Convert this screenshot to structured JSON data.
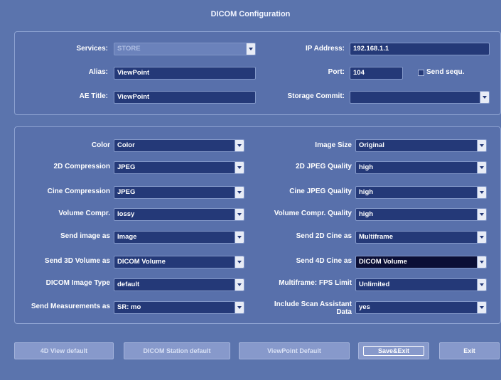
{
  "title": "DICOM Configuration",
  "top": {
    "services": {
      "label": "Services:",
      "value": "STORE"
    },
    "alias": {
      "label": "Alias:",
      "value": "ViewPoint"
    },
    "ae_title": {
      "label": "AE Title:",
      "value": "ViewPoint"
    },
    "ip_address": {
      "label": "IP Address:",
      "value": "192.168.1.1"
    },
    "port": {
      "label": "Port:",
      "value": "104"
    },
    "send_sequ": {
      "label": "Send sequ.",
      "checked": false
    },
    "storage_commit": {
      "label": "Storage Commit:",
      "value": ""
    }
  },
  "settings": {
    "color": {
      "label": "Color",
      "value": "Color"
    },
    "compression_2d": {
      "label": "2D Compression",
      "value": "JPEG"
    },
    "cine_compression": {
      "label": "Cine Compression",
      "value": "JPEG"
    },
    "volume_compr": {
      "label": "Volume Compr.",
      "value": "lossy"
    },
    "send_image_as": {
      "label": "Send image as",
      "value": "Image"
    },
    "send_3d_volume_as": {
      "label": "Send 3D Volume as",
      "value": "DICOM Volume"
    },
    "dicom_image_type": {
      "label": "DICOM Image Type",
      "value": "default"
    },
    "send_measurements_as": {
      "label": "Send Measurements as",
      "value": "SR: mo"
    },
    "image_size": {
      "label": "Image Size",
      "value": "Original"
    },
    "jpeg_quality_2d": {
      "label": "2D JPEG Quality",
      "value": "high"
    },
    "cine_jpeg_quality": {
      "label": "Cine JPEG Quality",
      "value": "high"
    },
    "volume_compr_quality": {
      "label": "Volume Compr. Quality",
      "value": "high"
    },
    "send_2d_cine_as": {
      "label": "Send 2D Cine as",
      "value": "Multiframe"
    },
    "send_4d_cine_as": {
      "label": "Send 4D Cine as",
      "value": "DICOM Volume"
    },
    "multiframe_fps_limit": {
      "label": "Multiframe: FPS Limit",
      "value": "Unlimited"
    },
    "include_scan_assistant": {
      "label_line1": "Include Scan Assistant",
      "label_line2": "Data",
      "value": "yes"
    }
  },
  "buttons": {
    "sd_view_default": "4D View default",
    "dicom_station_default": "DICOM Station default",
    "viewpoint_default": "ViewPoint Default",
    "save_exit": "Save&Exit",
    "exit": "Exit"
  }
}
